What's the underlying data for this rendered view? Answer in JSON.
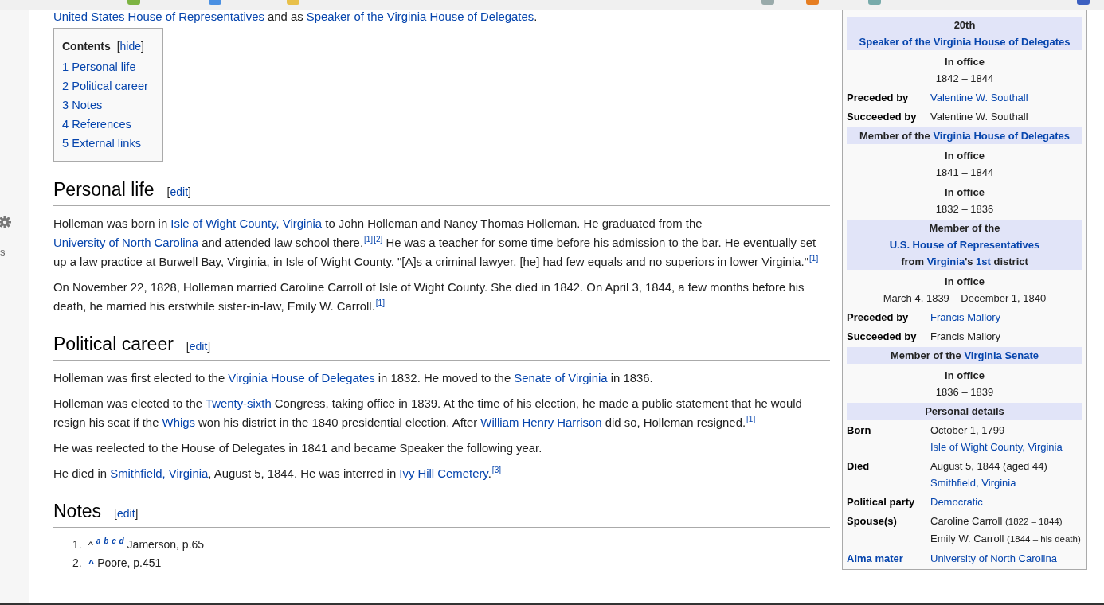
{
  "intro": [
    {
      "kind": "link",
      "text": "United States House of Representatives"
    },
    {
      "kind": "text",
      "text": " and as "
    },
    {
      "kind": "link",
      "text": "Speaker of the Virginia House of Delegates"
    },
    {
      "kind": "text",
      "text": "."
    }
  ],
  "sidebar": {
    "cut_text": "s"
  },
  "toc": {
    "title": "Contents",
    "toggle": {
      "open": "[",
      "label": "hide",
      "close": "]"
    },
    "items": [
      {
        "number": "1",
        "label": "Personal life"
      },
      {
        "number": "2",
        "label": "Political career"
      },
      {
        "number": "3",
        "label": "Notes"
      },
      {
        "number": "4",
        "label": "References"
      },
      {
        "number": "5",
        "label": "External links"
      }
    ]
  },
  "sections": [
    {
      "heading": "Personal life",
      "edit": {
        "open": "[",
        "label": "edit",
        "close": "]"
      },
      "paragraphs": [
        [
          {
            "kind": "text",
            "text": "Holleman was born in "
          },
          {
            "kind": "link",
            "text": "Isle of Wight County, Virginia"
          },
          {
            "kind": "text",
            "text": " to John Holleman and Nancy Thomas Holleman. He graduated from the "
          },
          {
            "kind": "link",
            "text": "University of North Carolina"
          },
          {
            "kind": "text",
            "text": " and attended law school there."
          },
          {
            "kind": "ref",
            "text": "[1]"
          },
          {
            "kind": "ref",
            "text": "[2]"
          },
          {
            "kind": "text",
            "text": " He was a teacher for some time before his admission to the bar. He eventually set up a law practice at Burwell Bay, Virginia, in Isle of Wight County. \"[A]s a criminal lawyer, [he] had few equals and no superiors in lower Virginia.\""
          },
          {
            "kind": "ref",
            "text": "[1]"
          }
        ],
        [
          {
            "kind": "text",
            "text": "On November 22, 1828, Holleman married Caroline Carroll of Isle of Wight County. She died in 1842. On April 3, 1844, a few months before his death, he married his erstwhile sister-in-law, Emily W. Carroll."
          },
          {
            "kind": "ref",
            "text": "[1]"
          }
        ]
      ]
    },
    {
      "heading": "Political career",
      "edit": {
        "open": "[",
        "label": "edit",
        "close": "]"
      },
      "paragraphs": [
        [
          {
            "kind": "text",
            "text": "Holleman was first elected to the "
          },
          {
            "kind": "link",
            "text": "Virginia House of Delegates"
          },
          {
            "kind": "text",
            "text": " in 1832. He moved to the "
          },
          {
            "kind": "link",
            "text": "Senate of Virginia"
          },
          {
            "kind": "text",
            "text": " in 1836."
          }
        ],
        [
          {
            "kind": "text",
            "text": "Holleman was elected to the "
          },
          {
            "kind": "link",
            "text": "Twenty-sixth"
          },
          {
            "kind": "text",
            "text": " Congress, taking office in 1839. At the time of his election, he made a public statement that he would resign his seat if the "
          },
          {
            "kind": "link",
            "text": "Whigs"
          },
          {
            "kind": "text",
            "text": " won his district in the 1840 presidential election. After "
          },
          {
            "kind": "link",
            "text": "William Henry Harrison"
          },
          {
            "kind": "text",
            "text": " did so, Holleman resigned."
          },
          {
            "kind": "ref",
            "text": "[1]"
          }
        ],
        [
          {
            "kind": "text",
            "text": "He was reelected to the House of Delegates in 1841 and became Speaker the following year."
          }
        ],
        [
          {
            "kind": "text",
            "text": "He died in "
          },
          {
            "kind": "link",
            "text": "Smithfield, Virginia"
          },
          {
            "kind": "text",
            "text": ", August 5, 1844. He was interred in "
          },
          {
            "kind": "link",
            "text": "Ivy Hill Cemetery"
          },
          {
            "kind": "text",
            "text": "."
          },
          {
            "kind": "ref",
            "text": "[3]"
          }
        ]
      ]
    },
    {
      "heading": "Notes",
      "edit": {
        "open": "[",
        "label": "edit",
        "close": "]"
      }
    }
  ],
  "notes": [
    {
      "number": "1.",
      "caret": "^",
      "caret_link": false,
      "letters": [
        "a",
        "b",
        "c",
        "d"
      ],
      "text": "Jamerson, p.65"
    },
    {
      "number": "2.",
      "caret": "^",
      "caret_link": true,
      "text": "Poore, p.451"
    }
  ],
  "infobox": {
    "rows": [
      {
        "kind": "header",
        "segments": [
          {
            "kind": "text",
            "text": "20th "
          },
          {
            "kind": "link",
            "text": "Speaker of the Virginia House of Delegates"
          }
        ]
      },
      {
        "kind": "subheader",
        "text": "In office"
      },
      {
        "kind": "centered",
        "text": "1842 – 1844"
      },
      {
        "kind": "field",
        "label": "Preceded by",
        "lines": [
          [
            {
              "kind": "link",
              "text": "Valentine W. Southall"
            }
          ]
        ]
      },
      {
        "kind": "field",
        "label": "Succeeded by",
        "lines": [
          [
            {
              "kind": "text",
              "text": "Valentine W. Southall"
            }
          ]
        ]
      },
      {
        "kind": "header",
        "segments": [
          {
            "kind": "text",
            "text": "Member of the "
          },
          {
            "kind": "link",
            "text": "Virginia House of Delegates"
          }
        ]
      },
      {
        "kind": "subheader",
        "text": "In office"
      },
      {
        "kind": "centered",
        "text": "1841 – 1844"
      },
      {
        "kind": "subheader",
        "text": "In office"
      },
      {
        "kind": "centered",
        "text": "1832 – 1836"
      },
      {
        "kind": "header",
        "segments": [
          {
            "kind": "text",
            "text": "Member of the "
          },
          {
            "kind": "link",
            "text": "U.S. House of Representatives"
          },
          {
            "kind": "break"
          },
          {
            "kind": "text",
            "text": "from "
          },
          {
            "kind": "link",
            "text": "Virginia"
          },
          {
            "kind": "text",
            "text": "'s "
          },
          {
            "kind": "link",
            "text": "1st"
          },
          {
            "kind": "text",
            "text": " district"
          }
        ]
      },
      {
        "kind": "subheader",
        "text": "In office"
      },
      {
        "kind": "centered",
        "text": "March 4, 1839 – December 1, 1840"
      },
      {
        "kind": "field",
        "label": "Preceded by",
        "lines": [
          [
            {
              "kind": "link",
              "text": "Francis Mallory"
            }
          ]
        ]
      },
      {
        "kind": "field",
        "label": "Succeeded by",
        "lines": [
          [
            {
              "kind": "text",
              "text": "Francis Mallory"
            }
          ]
        ]
      },
      {
        "kind": "header",
        "segments": [
          {
            "kind": "text",
            "text": "Member of the "
          },
          {
            "kind": "link",
            "text": "Virginia Senate"
          }
        ]
      },
      {
        "kind": "subheader",
        "text": "In office"
      },
      {
        "kind": "centered",
        "text": "1836 – 1839"
      },
      {
        "kind": "header",
        "segments": [
          {
            "kind": "text",
            "text": "Personal details"
          }
        ]
      },
      {
        "kind": "field",
        "label": "Born",
        "lines": [
          [
            {
              "kind": "text",
              "text": "October 1, 1799"
            }
          ],
          [
            {
              "kind": "link",
              "text": "Isle of Wight County, Virginia"
            }
          ]
        ]
      },
      {
        "kind": "field",
        "label": "Died",
        "lines": [
          [
            {
              "kind": "text",
              "text": "August 5, 1844 (aged 44)"
            }
          ],
          [
            {
              "kind": "link",
              "text": "Smithfield, Virginia"
            }
          ]
        ]
      },
      {
        "kind": "field",
        "label": "Political party",
        "lines": [
          [
            {
              "kind": "link",
              "text": "Democratic"
            }
          ]
        ]
      },
      {
        "kind": "field",
        "label": "Spouse(s)",
        "lines": [
          [
            {
              "kind": "text",
              "text": "Caroline Carroll "
            },
            {
              "kind": "small",
              "text": "(1822 – 1844)"
            }
          ],
          [
            {
              "kind": "text",
              "text": "Emily W. Carroll "
            },
            {
              "kind": "small",
              "text": "(1844 – his death)"
            }
          ]
        ]
      },
      {
        "kind": "field",
        "label": "Alma mater",
        "label_link": true,
        "lines": [
          [
            {
              "kind": "link",
              "text": "University of North Carolina"
            }
          ]
        ]
      }
    ]
  }
}
